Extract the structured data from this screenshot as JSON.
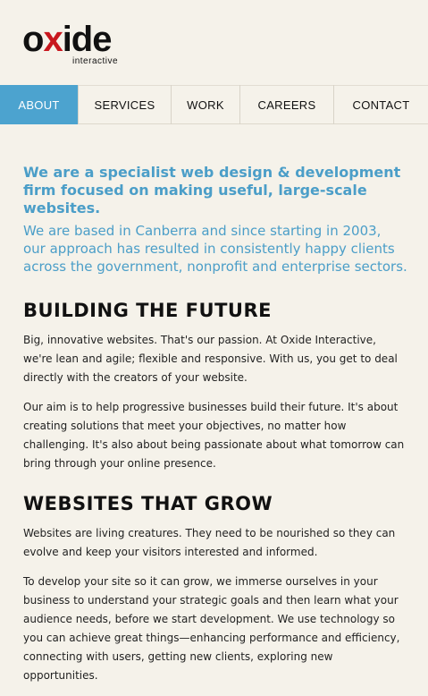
{
  "logo": {
    "wordmark_pre": "o",
    "wordmark_x": "x",
    "wordmark_post": "ide",
    "tagline": "interactive"
  },
  "nav": {
    "items": [
      {
        "label": "ABOUT",
        "active": true
      },
      {
        "label": "SERVICES",
        "active": false
      },
      {
        "label": "WORK",
        "active": false
      },
      {
        "label": "CAREERS",
        "active": false
      },
      {
        "label": "CONTACT",
        "active": false
      }
    ]
  },
  "intro": {
    "lead": "We are a specialist web design & development firm focused on making useful, large-scale websites.",
    "sublead": "We are based in Canberra and since starting in 2003, our approach has resulted in consistently happy clients across the government, nonprofit and enterprise sectors."
  },
  "sections": [
    {
      "heading": "BUILDING THE FUTURE",
      "paragraphs": [
        "Big, innovative websites. That's our passion. At Oxide Interactive, we're lean and agile; flexible and responsive. With us, you get to deal directly with the creators of your website.",
        "Our aim is to help progressive businesses build their future. It's about creating solutions that meet your objectives, no matter how challenging. It's also about being passionate about what tomorrow can bring through your online presence."
      ]
    },
    {
      "heading": "WEBSITES THAT GROW",
      "paragraphs": [
        "Websites are living creatures. They need to be nourished so they can evolve and keep your visitors interested and informed.",
        "To develop your site so it can grow, we immerse ourselves in your business to understand your strategic goals and then learn what your audience needs, before we start development. We use technology so you can achieve great things—enhancing performance and efficiency, connecting with users, getting new clients, exploring new opportunities."
      ]
    }
  ],
  "colors": {
    "accent": "#4ca3cf",
    "logo_red": "#c8171e",
    "text": "#222222",
    "background": "#f5f2ea"
  }
}
